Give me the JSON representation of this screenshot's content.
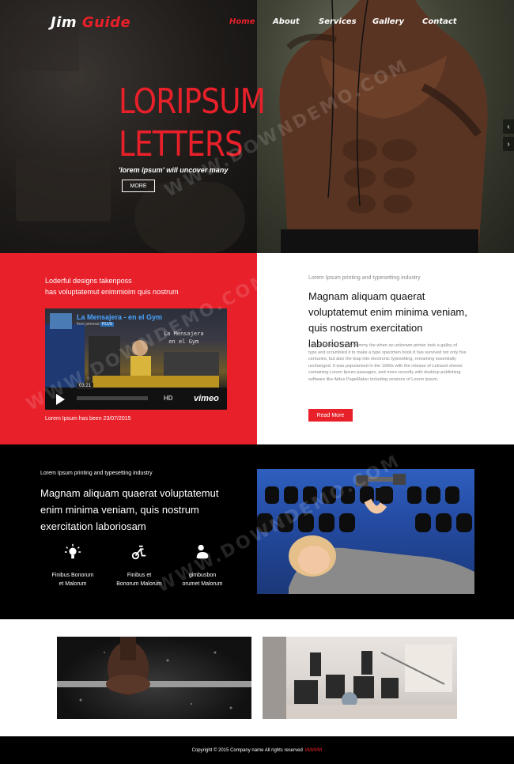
{
  "brand": {
    "logo_first": "Jim",
    "logo_second": "Guide"
  },
  "nav": {
    "items": [
      "Home",
      "About",
      "Services",
      "Gallery",
      "Contact"
    ],
    "active": "Home"
  },
  "hero": {
    "title_line1": "LORIPSUM",
    "title_line2": "LETTERS",
    "subtitle": "'lorem ipsum' will uncover many",
    "button": "MORE"
  },
  "section_two": {
    "left_line1": "Loderful designs takenposs",
    "left_line2": "has voluptatemut enimmioim quis nostrum",
    "video": {
      "title": "La Mensajera - en el Gym",
      "from_prefix": "from",
      "from_user": "jamesal",
      "from_badge": "PLUS",
      "channel_line1": "La Mensajera",
      "channel_line2": "en el Gym",
      "time": "03:21",
      "hd": "HD",
      "provider": "vimeo"
    },
    "date_text": "Lorem Ipsum has been 23/07/2015",
    "right_small": "Lorem Ipsum printing and typesetting industry",
    "right_heading": "Magnam aliquam quaerat voluptatemut enim minima veniam, quis nostrum exercitation laboriosam",
    "right_body": "Lorem Ipsum is simply dummy the when an unknown printer took a galley of type and scrambled it to make a type specimen book.It has survived not only five centuries, but also the leap into electronic typesetting, remaining essentially unchanged. It was popularised in the 1960s with the release of Letraset sheets containing Lorem Ipsum passages, and more recently with desktop publishing software like Aldus PageMaker including versions of Lorem Ipsum.",
    "read_more": "Read More"
  },
  "section_three": {
    "small": "Lorem Ipsum printing and typesetting industry",
    "heading": "Magnam aliquam quaerat voluptatemut enim minima veniam, quis nostrum exercitation laboriosam",
    "features": [
      {
        "icon": "sparkle-icon",
        "line1": "Finibus Bonorum",
        "line2": "et Malorum"
      },
      {
        "icon": "exercise-bike-icon",
        "line1": "Finibus et",
        "line2": "Bonorum Malorum"
      },
      {
        "icon": "flexed-arm-icon",
        "line1": "gimbusbon",
        "line2": "orumet Malorum"
      }
    ]
  },
  "footer": {
    "text": "Copyright © 2015 Company name All rights reserved",
    "link": "ИИИИИ"
  },
  "watermark": "WWW.DOWNDEMO.COM",
  "colors": {
    "accent": "#e8202a",
    "dark": "#000000",
    "white": "#ffffff"
  }
}
